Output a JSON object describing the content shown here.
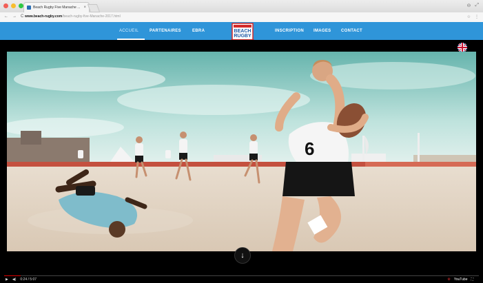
{
  "browser": {
    "tab_title": "Beach Rugby Five Manache ...",
    "tab_close": "×",
    "url_host": "www.beach-rugby.com",
    "url_path": "/beach-rugby-five-Manache-2017.html",
    "back": "←",
    "forward": "→",
    "reload": "C",
    "window_icons": [
      "⊖",
      "⤢"
    ],
    "addr_icons": [
      "☆",
      "⋮"
    ]
  },
  "nav": {
    "items": [
      "ACCUEIL",
      "PARTENAIRES",
      "EBRA",
      "INSCRIPTION",
      "IMAGES",
      "CONTACT"
    ],
    "active": "ACCUEIL",
    "logo_text": [
      "BEACH",
      "RUGBY"
    ]
  },
  "hero": {
    "jersey_number": "6",
    "scroll_icon": "↓"
  },
  "player": {
    "play": "▶",
    "volume": "◀)",
    "time": "0:24 / 5:07",
    "progress": 0.035,
    "youtube_label": "YouTube",
    "settings_icon": "⚙",
    "fullscreen_icon": "⛶"
  },
  "colors": {
    "nav_blue": "#2f95d9",
    "logo_red": "#d22a2a",
    "progress_red": "#dd0000"
  }
}
